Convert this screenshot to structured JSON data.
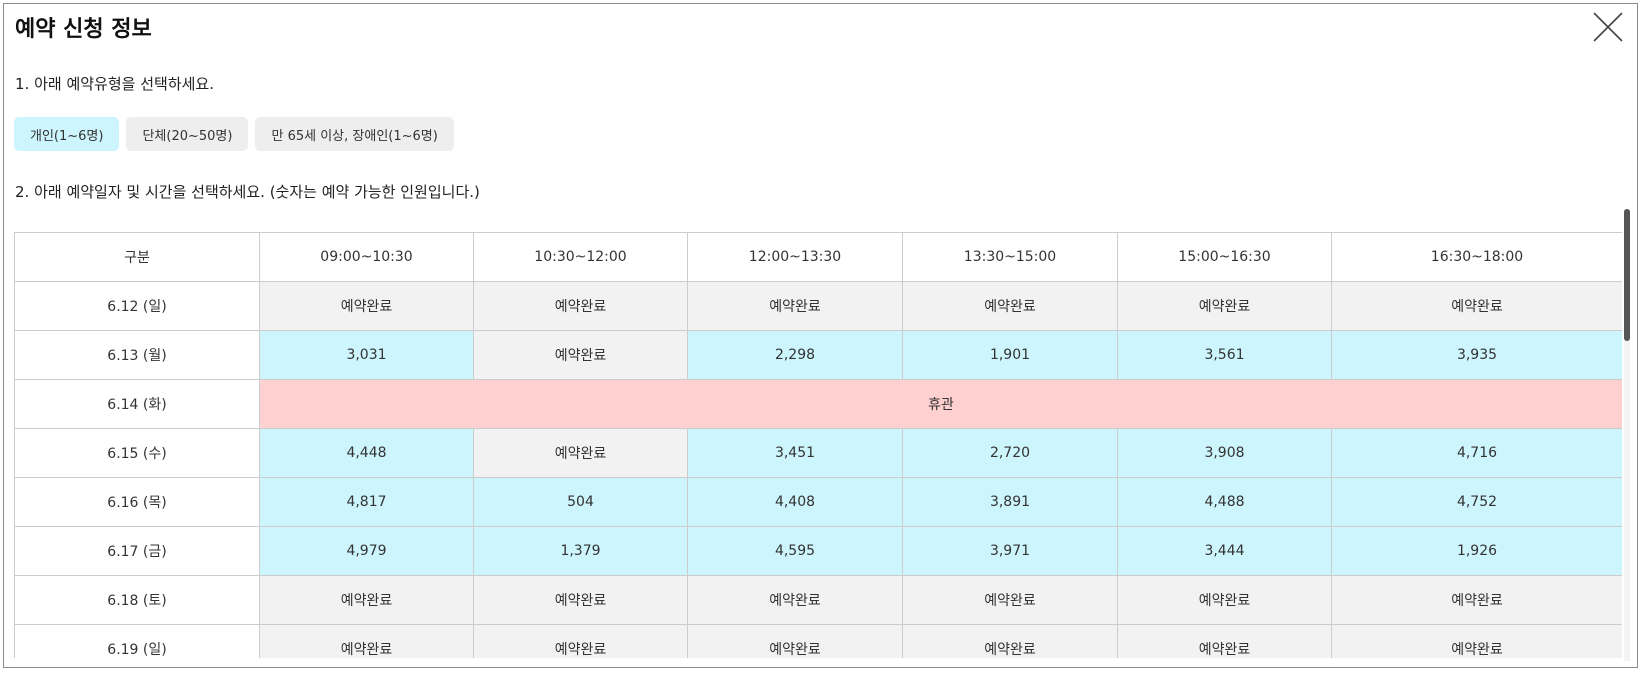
{
  "dialog": {
    "title": "예약 신청 정보",
    "close_icon": "close-icon"
  },
  "step1": {
    "instruction": "1. 아래 예약유형을 선택하세요.",
    "options": [
      {
        "label": "개인(1~6명)",
        "selected": true
      },
      {
        "label": "단체(20~50명)",
        "selected": false
      },
      {
        "label": "만 65세 이상, 장애인(1~6명)",
        "selected": false
      }
    ]
  },
  "step2": {
    "instruction": "2. 아래 예약일자 및 시간을 선택하세요. (숫자는 예약 가능한 인원입니다.)"
  },
  "schedule": {
    "header": [
      "구분",
      "09:00~10:30",
      "10:30~12:00",
      "12:00~13:30",
      "13:30~15:00",
      "15:00~16:30",
      "16:30~18:00"
    ],
    "rows": [
      {
        "date": "6.12 (일)",
        "slots": [
          "예약완료",
          "예약완료",
          "예약완료",
          "예약완료",
          "예약완료",
          "예약완료"
        ]
      },
      {
        "date": "6.13 (월)",
        "slots": [
          "3,031",
          "예약완료",
          "2,298",
          "1,901",
          "3,561",
          "3,935"
        ]
      },
      {
        "date": "6.14 (화)",
        "closed": "휴관"
      },
      {
        "date": "6.15 (수)",
        "slots": [
          "4,448",
          "예약완료",
          "3,451",
          "2,720",
          "3,908",
          "4,716"
        ]
      },
      {
        "date": "6.16 (목)",
        "slots": [
          "4,817",
          "504",
          "4,408",
          "3,891",
          "4,488",
          "4,752"
        ]
      },
      {
        "date": "6.17 (금)",
        "slots": [
          "4,979",
          "1,379",
          "4,595",
          "3,971",
          "3,444",
          "1,926"
        ]
      },
      {
        "date": "6.18 (토)",
        "slots": [
          "예약완료",
          "예약완료",
          "예약완료",
          "예약완료",
          "예약완료",
          "예약완료"
        ]
      },
      {
        "date": "6.19 (일)",
        "slots": [
          "예약완료",
          "예약완료",
          "예약완료",
          "예약완료",
          "예약완료",
          "예약완료"
        ]
      }
    ],
    "done_text": "예약완료"
  },
  "colors": {
    "available": "#cdf5fd",
    "done": "#f2f2f2",
    "closed": "#ffd0d0",
    "selected_option": "#cdf5fd"
  }
}
